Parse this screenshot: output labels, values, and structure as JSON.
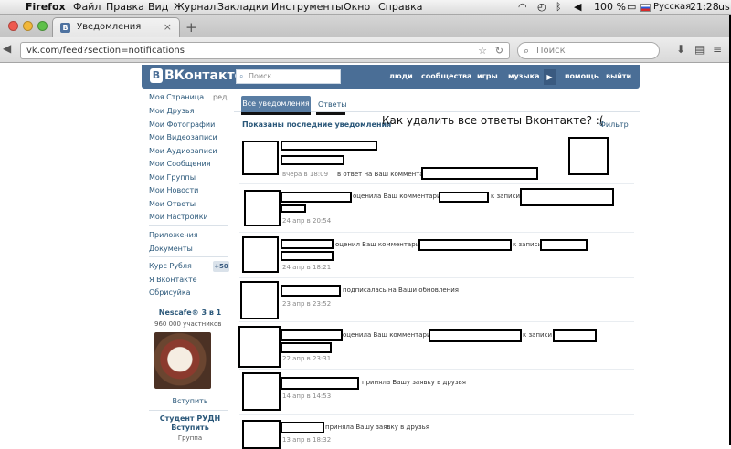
{
  "os_menubar": {
    "app": "Firefox",
    "items": [
      "Файл",
      "Правка",
      "Вид",
      "Журнал",
      "Закладки",
      "Инструменты",
      "Окно",
      "Справка"
    ],
    "battery": "100 %",
    "input_source": "Русская",
    "time": "21:28",
    "user": "us"
  },
  "browser": {
    "tab_title": "Уведомления",
    "url": "vk.com/feed?section=notifications",
    "search_placeholder": "Поиск"
  },
  "vk": {
    "logo": "ВКонтакте",
    "logo_letter": "В",
    "search_placeholder": "Поиск",
    "nav": [
      "люди",
      "сообщества",
      "игры",
      "музыка",
      "помощь",
      "выйти"
    ],
    "menu": {
      "items": [
        "Моя Страница",
        "Мои Друзья",
        "Мои Фотографии",
        "Мои Видеозаписи",
        "Мои Аудиозаписи",
        "Мои Сообщения",
        "Мои Группы",
        "Мои Новости",
        "Мои Ответы",
        "Мои Настройки"
      ],
      "edit": "ред.",
      "extra": [
        "Приложения",
        "Документы"
      ],
      "extra2": [
        "Курс Рубля",
        "Я Вконтакте",
        "Обрисуйка"
      ],
      "rate_badge": "+50"
    },
    "ads": [
      {
        "title": "Nescafe® 3 в 1",
        "subtitle": "960 000 участников",
        "action": "Вступить"
      },
      {
        "title": "Студент РУДН",
        "action": "Вступить",
        "subtitle": "Группа"
      }
    ],
    "tabs": {
      "all": "Все уведомления",
      "answers": "Ответы"
    },
    "shown_label": "Показаны последние уведомления",
    "filter": "Фильтр",
    "overlay_question": "Как удалить все ответы Вконтакте? :(",
    "notifications": [
      {
        "date": "вчера в 18:09",
        "text": "в ответ на Ваш комментарий"
      },
      {
        "date": "24 апр в 20:54",
        "text": "оценила Ваш комментарий",
        "text2": "к записи"
      },
      {
        "date": "24 апр в 18:21",
        "text": "оценил Ваш комментарий",
        "text2": "к записи"
      },
      {
        "date": "23 апр в 23:52",
        "text": "подписалась на Ваши обновления"
      },
      {
        "date": "22 апр в 23:31",
        "text": "оценила Ваш комментарий",
        "text2": "к записи"
      },
      {
        "date": "14 апр в 14:53",
        "text": "приняла Вашу заявку в друзья"
      },
      {
        "date": "13 апр в 18:32",
        "text": "приняла Вашу заявку в друзья"
      }
    ]
  }
}
